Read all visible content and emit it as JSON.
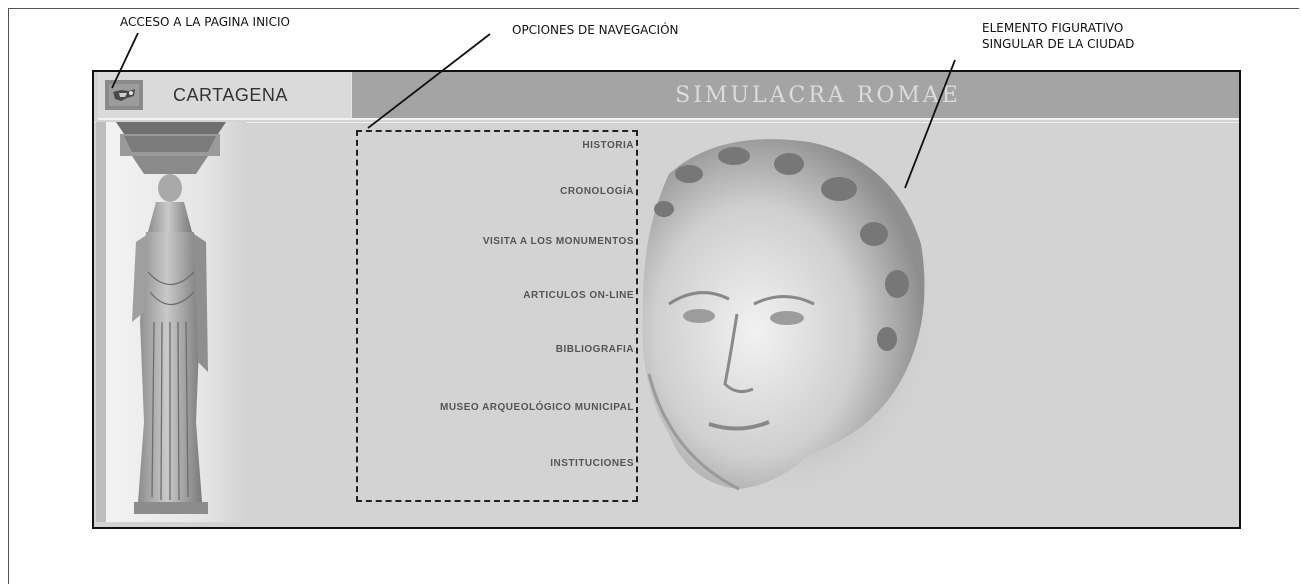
{
  "annotations": {
    "home": "ACCESO A LA PAGINA INICIO",
    "navigation": "OPCIONES DE NAVEGACIÓN",
    "figurative_line1": "ELEMENTO FIGURATIVO",
    "figurative_line2": "SINGULAR DE LA CIUDAD"
  },
  "site": {
    "home_label": "CARTAGENA",
    "title": "SIMULACRA ROMAE",
    "nav": [
      "HISTORIA",
      "CRONOLOGÍA",
      "VISITA A LOS MONUMENTOS",
      "ARTICULOS ON-LINE",
      "BIBLIOGRAFIA",
      "MUSEO ARQUEOLÓGICO MUNICIPAL",
      "INSTITUCIONES"
    ]
  },
  "colors": {
    "page_bg": "#d3d3d3",
    "title_bar": "#a4a4a4",
    "home_cell": "#dadada"
  }
}
